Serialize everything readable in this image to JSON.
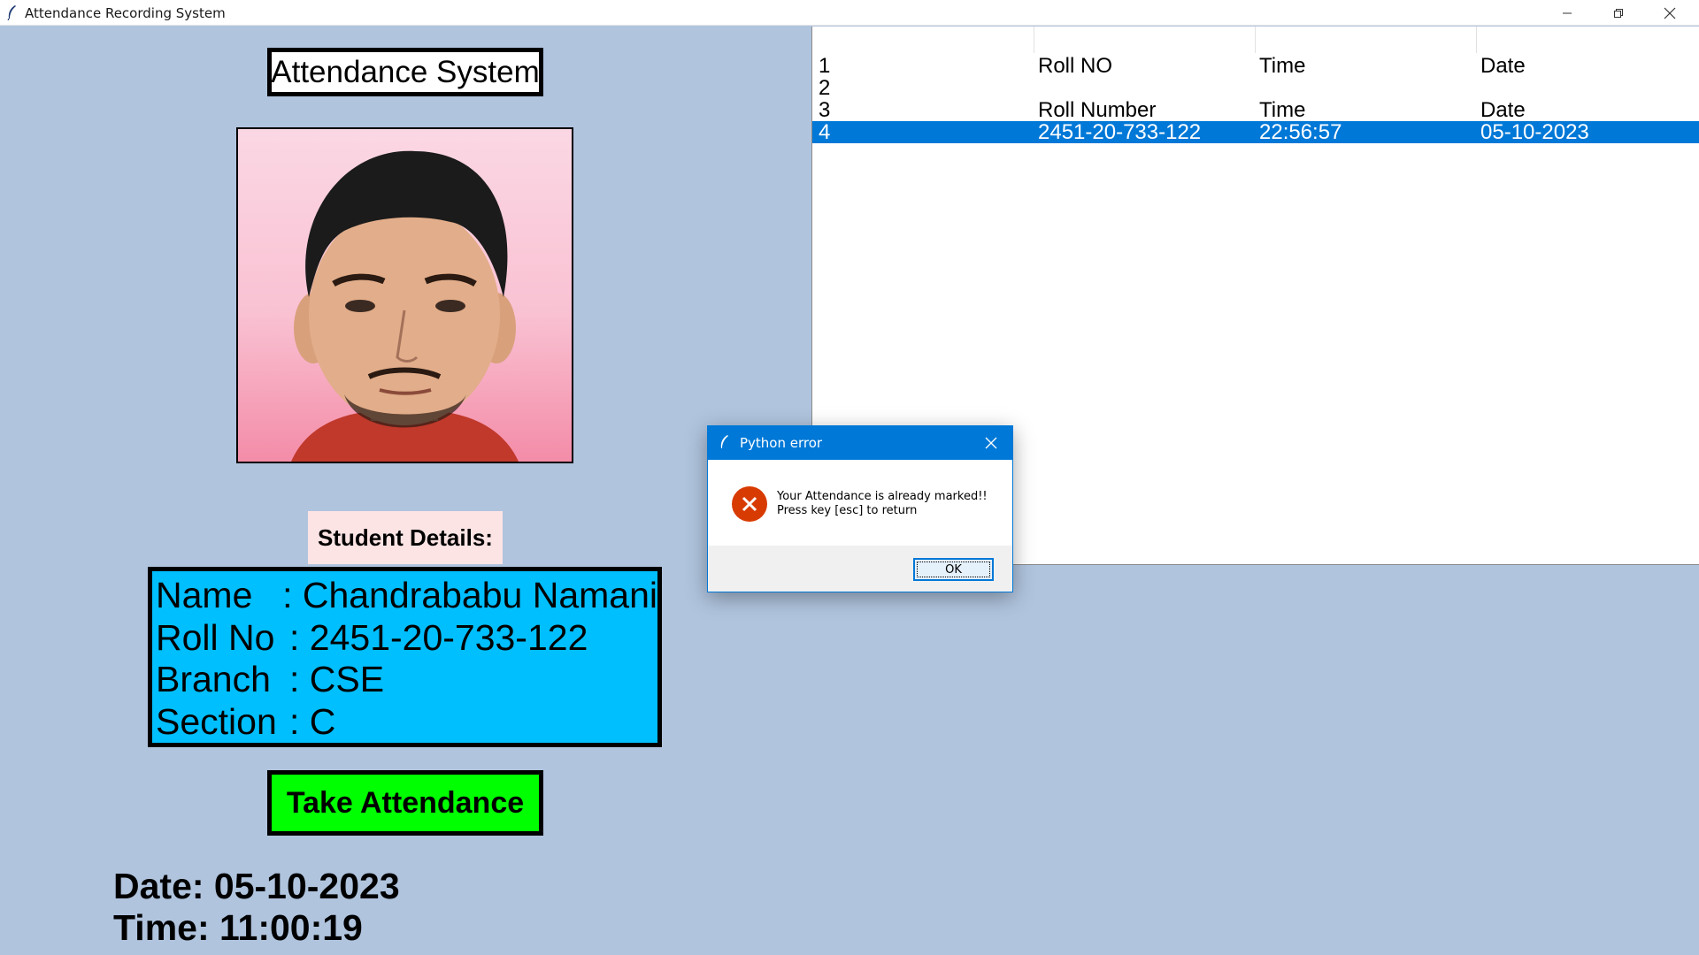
{
  "window": {
    "title": "Attendance Recording System",
    "bg_color": "#b0c4de"
  },
  "left_panel": {
    "heading": "Attendance System",
    "photo": {
      "icon": "student-photo",
      "description_visible": false
    },
    "details_label": "Student Details:",
    "details": [
      {
        "key": "Name",
        "value": ": Chandrababu Namani"
      },
      {
        "key": "Roll No",
        "value": ": 2451-20-733-122"
      },
      {
        "key": "Branch",
        "value": ": CSE"
      },
      {
        "key": "Section",
        "value": ": C"
      }
    ],
    "take_attendance_label": "Take Attendance",
    "date_line": "Date: 05-10-2023",
    "time_line": "Time: 11:00:19",
    "colors": {
      "details_bg": "#00bfff",
      "button_bg": "#00ff00",
      "label_bg": "#fde4e4"
    }
  },
  "table": {
    "rows": [
      {
        "num": "1",
        "c1": "Roll NO",
        "c2": "Time",
        "c3": "Date",
        "selected": false
      },
      {
        "num": "2",
        "c1": "",
        "c2": "",
        "c3": "",
        "selected": false
      },
      {
        "num": "3",
        "c1": "Roll Number",
        "c2": "Time",
        "c3": "Date",
        "selected": false
      },
      {
        "num": "4",
        "c1": "2451-20-733-122",
        "c2": "22:56:57",
        "c3": "05-10-2023",
        "selected": true
      }
    ],
    "selection_color": "#0078d7"
  },
  "dialog": {
    "title": "Python error",
    "message_line1": "Your Attendance is already marked!!",
    "message_line2": "Press key [esc] to return",
    "ok_label": "OK",
    "icon": "error-icon",
    "accent": "#0078d7"
  }
}
